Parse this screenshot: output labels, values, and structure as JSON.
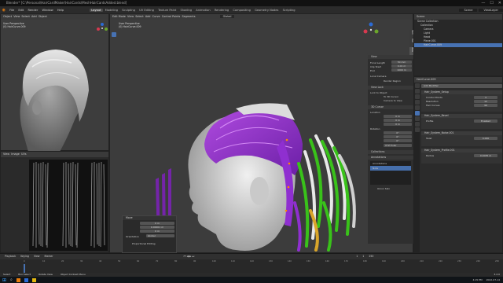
{
  "window": {
    "title": "Blender* [C:\\Personal\\HairCardMaker\\HairCards\\MeshHairCardsAdded.blend]",
    "controls": [
      "—",
      "☐",
      "✕"
    ]
  },
  "menus": [
    "File",
    "Edit",
    "Render",
    "Window",
    "Help"
  ],
  "workspaces": [
    "Layout",
    "Modeling",
    "Sculpting",
    "UV Editing",
    "Texture Paint",
    "Shading",
    "Animation",
    "Rendering",
    "Compositing",
    "Geometry Nodes",
    "Scripting"
  ],
  "active_workspace": "Layout",
  "scene": {
    "name": "Scene",
    "view_layer": "ViewLayer"
  },
  "left_viewport": {
    "title": "User Perspective",
    "subtitle": "(0) HairCurve.009",
    "header_items": [
      "Object",
      "View",
      "Select",
      "Add",
      "Object"
    ]
  },
  "uv_editor": {
    "header": [
      "View",
      "Image",
      "UVs"
    ]
  },
  "main_viewport": {
    "title": "User Perspective",
    "subtitle": "(0) HairCurve.009",
    "header_items": [
      "Edit Mode",
      "View",
      "Select",
      "Add",
      "Curve",
      "Control Points",
      "Segments"
    ],
    "orientation": "Global"
  },
  "n_panel": {
    "tabs": [
      "Item",
      "Tool",
      "View"
    ],
    "view_section": "View",
    "focal_length": "50 mm",
    "clip_start": "0.01 m",
    "clip_end": "1000 m",
    "local_camera": "Local Camera",
    "render_region": "Render Region",
    "view_lock": "View Lock",
    "lock_to_object": "Lock to Object",
    "lock_to_3d_cursor": "To 3D Cursor",
    "lock_camera_to_view": "Camera to View",
    "cursor_section": "3D Cursor",
    "location": "Location",
    "x": "0 m",
    "y": "0 m",
    "z": "0 m",
    "rotation": "Rotation",
    "rx": "0°",
    "ry": "0°",
    "rz": "0°",
    "mode": "XYZ Euler",
    "collections": "Collections",
    "annotations": "Annotations",
    "annotation_name": "Annotations",
    "annotation_note": "Note",
    "onion": "Onion Skin"
  },
  "redo_panel": {
    "title": "Move",
    "move_x": "0 m",
    "move_y": "0.00001 m",
    "move_z": "0 m",
    "orientation_label": "Orientation",
    "orientation": "Global",
    "proportional": "Proportional Editing"
  },
  "outliner": {
    "header": "Scene",
    "items": [
      "Scene Collection",
      "Collection",
      "Camera",
      "Light",
      "Head",
      "Plane.001",
      "HairCurve.009"
    ]
  },
  "properties": {
    "object": "HairCurve.009",
    "section": "Add Modifier",
    "modifiers": [
      "Hair_System_Setup",
      "Hair_System_Bevel",
      "Hair_System_Noise.001",
      "Hair_System_Profile.001"
    ],
    "fields": [
      {
        "label": "Control Points",
        "value": "4"
      },
      {
        "label": "Resolution",
        "value": "12"
      },
      {
        "label": "Hair Curves",
        "value": "96"
      },
      {
        "label": "Profile",
        "value": "Enabled"
      },
      {
        "label": "Twist",
        "value": "0.000"
      },
      {
        "label": "Radius",
        "value": "0.0035 m"
      }
    ]
  },
  "timeline": {
    "menus": [
      "Playback",
      "Keying",
      "View",
      "Marker"
    ],
    "frame": "1",
    "start": "1",
    "end": "250",
    "ticks": [
      "0",
      "10",
      "20",
      "30",
      "40",
      "50",
      "60",
      "70",
      "80",
      "90",
      "100",
      "110",
      "120",
      "130",
      "140",
      "150",
      "160",
      "170",
      "180",
      "190",
      "200",
      "210",
      "220",
      "230",
      "240",
      "250"
    ]
  },
  "statusbar": {
    "items": [
      "Select",
      "Box Select",
      "Rotate View",
      "Object Context Menu"
    ],
    "version": "3.2.0"
  },
  "taskbar": {
    "time": "4:15 PM",
    "date": "2022-07-14"
  }
}
